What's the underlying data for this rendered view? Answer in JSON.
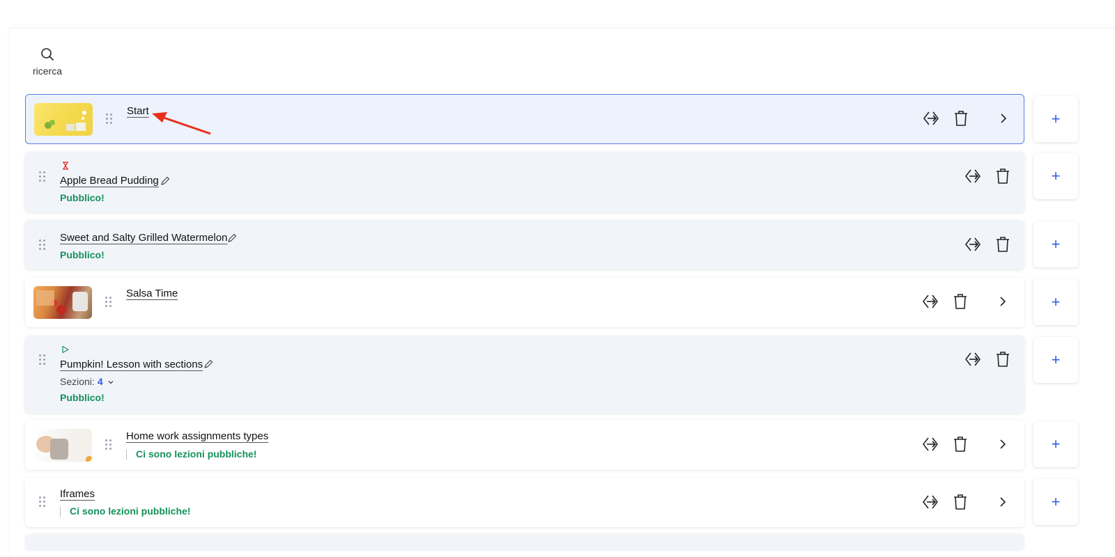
{
  "search": {
    "label": "ricerca"
  },
  "items": [
    {
      "title": "Start",
      "status": "",
      "sections_label": "",
      "sections_count": ""
    },
    {
      "title": "Apple Bread Pudding",
      "status": "Pubblico!"
    },
    {
      "title": "Sweet and Salty Grilled Watermelon",
      "status": "Pubblico!"
    },
    {
      "title": "Salsa Time",
      "status": ""
    },
    {
      "title": "Pumpkin! Lesson with sections",
      "status": "Pubblico!",
      "sections_label": "Sezioni:",
      "sections_count": "4"
    },
    {
      "title": "Home work assignments types",
      "status": "Ci sono lezioni pubbliche!"
    },
    {
      "title": "Iframes",
      "status": "Ci sono lezioni pubbliche!"
    }
  ],
  "add_label": "+",
  "icons": [
    "search-icon",
    "drag-handle-icon",
    "move-icon",
    "trash-icon",
    "chevron-right-icon",
    "pencil-icon",
    "hourglass-icon",
    "play-icon",
    "chevron-down-icon",
    "plus-icon"
  ],
  "colors": {
    "accent": "#2f5fe6",
    "public": "#14915c",
    "selected_border": "#5a7fe0",
    "pending": "#e02d2d"
  }
}
